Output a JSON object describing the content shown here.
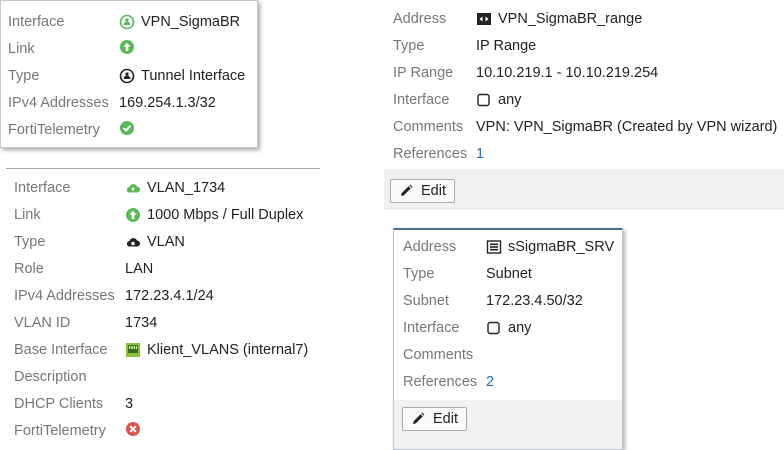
{
  "tooltip": {
    "rows": [
      {
        "label": "Interface",
        "value": "VPN_SigmaBR",
        "icon": "tunnel-interface-icon"
      },
      {
        "label": "Link",
        "value": "",
        "icon": "link-up-arrow-icon"
      },
      {
        "label": "Type",
        "value": "Tunnel Interface",
        "icon": "tunnel-type-icon"
      },
      {
        "label": "IPv4 Addresses",
        "value": "169.254.1.3/32"
      },
      {
        "label": "FortiTelemetry",
        "value": "",
        "icon": "check-circle-icon"
      }
    ]
  },
  "vlan_panel": {
    "rows": [
      {
        "label": "Interface",
        "value": "VLAN_1734",
        "icon": "vlan-cloud-icon"
      },
      {
        "label": "Link",
        "value": "1000 Mbps / Full Duplex",
        "icon": "link-up-arrow-icon"
      },
      {
        "label": "Type",
        "value": "VLAN",
        "icon": "vlan-type-icon"
      },
      {
        "label": "Role",
        "value": "LAN"
      },
      {
        "label": "IPv4 Addresses",
        "value": "172.23.4.1/24"
      },
      {
        "label": "VLAN ID",
        "value": "1734"
      },
      {
        "label": "Base Interface",
        "value": "Klient_VLANS (internal7)",
        "icon": "port-icon"
      },
      {
        "label": "Description",
        "value": ""
      },
      {
        "label": "DHCP Clients",
        "value": "3"
      },
      {
        "label": "FortiTelemetry",
        "value": "",
        "icon": "x-circle-icon"
      }
    ]
  },
  "range_panel": {
    "rows": [
      {
        "label": "Address",
        "value": "VPN_SigmaBR_range",
        "icon": "ip-range-icon"
      },
      {
        "label": "Type",
        "value": "IP Range"
      },
      {
        "label": "IP Range",
        "value": "10.10.219.1 - 10.10.219.254"
      },
      {
        "label": "Interface",
        "value": "any",
        "icon": "interface-any-icon"
      },
      {
        "label": "Comments",
        "value": "VPN: VPN_SigmaBR (Created by VPN wizard)"
      },
      {
        "label": "References",
        "value": "1"
      }
    ],
    "edit_label": "Edit"
  },
  "srv_panel": {
    "rows": [
      {
        "label": "Address",
        "value": "sSigmaBR_SRV",
        "icon": "subnet-address-icon"
      },
      {
        "label": "Type",
        "value": "Subnet"
      },
      {
        "label": "Subnet",
        "value": "172.23.4.50/32"
      },
      {
        "label": "Interface",
        "value": "any",
        "icon": "interface-any-icon"
      },
      {
        "label": "Comments",
        "value": ""
      },
      {
        "label": "References",
        "value": "2"
      }
    ],
    "edit_label": "Edit"
  },
  "colors": {
    "green": "#5cb85c",
    "red": "#d9534f",
    "link": "#2d6ea6",
    "label": "#777777"
  }
}
